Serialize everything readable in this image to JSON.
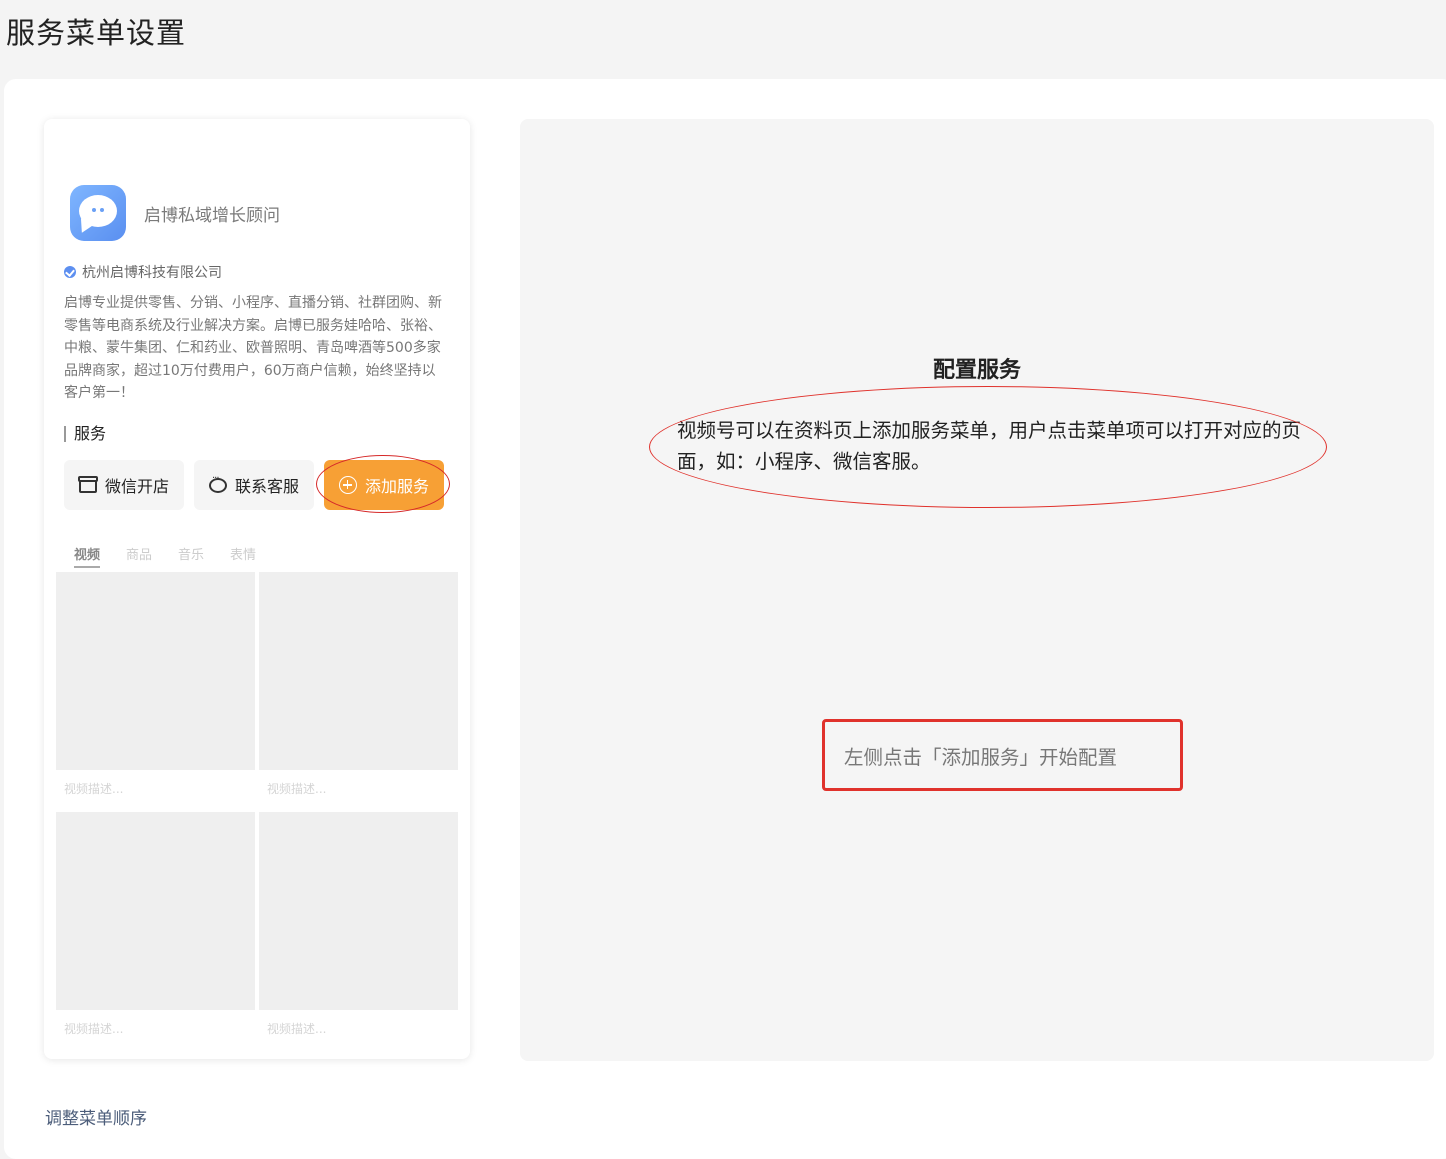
{
  "page": {
    "title": "服务菜单设置"
  },
  "preview": {
    "account_name": "启博私域增长顾问",
    "company": "杭州启博科技有限公司",
    "intro": "启博专业提供零售、分销、小程序、直播分销、社群团购、新零售等电商系统及行业解决方案。启博已服务娃哈哈、张裕、中粮、蒙牛集团、仁和药业、欧普照明、青岛啤酒等500多家品牌商家，超过10万付费用户，60万商户信赖，始终坚持以客户第一！",
    "section_title": "服务",
    "services": [
      {
        "label": "微信开店",
        "icon": "store-icon"
      },
      {
        "label": "联系客服",
        "icon": "chat-icon"
      }
    ],
    "add_service_label": "添加服务",
    "tabs": [
      {
        "label": "视频",
        "active": true
      },
      {
        "label": "商品",
        "active": false
      },
      {
        "label": "音乐",
        "active": false
      },
      {
        "label": "表情",
        "active": false
      }
    ],
    "videos": [
      {
        "desc": "视频描述..."
      },
      {
        "desc": "视频描述..."
      },
      {
        "desc": "视频描述..."
      },
      {
        "desc": "视频描述..."
      }
    ]
  },
  "config": {
    "title": "配置服务",
    "description": "视频号可以在资料页上添加服务菜单，用户点击菜单项可以打开对应的页面，如：小程序、微信客服。",
    "hint": "左侧点击「添加服务」开始配置"
  },
  "footer": {
    "adjust_order_label": "调整菜单顺序"
  },
  "colors": {
    "accent": "#f7a035",
    "annotation": "#e0322c",
    "link": "#4c5d7a"
  }
}
